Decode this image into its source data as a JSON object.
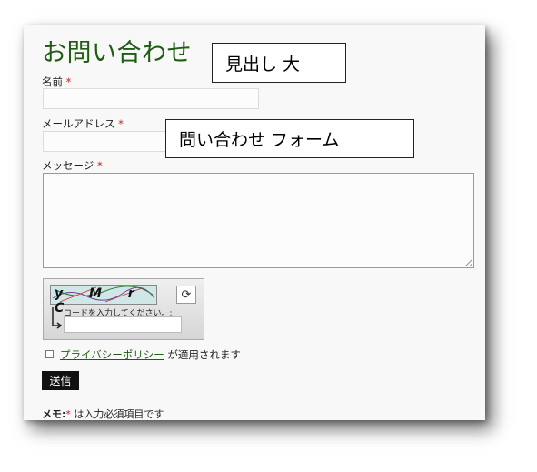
{
  "form": {
    "title": "お問い合わせ",
    "name_label": "名前",
    "email_label": "メールアドレス",
    "message_label": "メッセージ",
    "required_mark": "*",
    "captcha_text": "y M r C",
    "captcha_hint": "コードを入力してください。:",
    "privacy_link": "プライバシーポリシー",
    "privacy_suffix": " が適用されます",
    "submit_label": "送信",
    "memo_label": "メモ:",
    "memo_text": " は入力必須項目です"
  },
  "callouts": {
    "heading": "見出し 大",
    "form": "問い合わせ フォーム"
  },
  "colors": {
    "title": "#1f5d12",
    "required": "#cc1a1a",
    "button_bg": "#111111"
  }
}
